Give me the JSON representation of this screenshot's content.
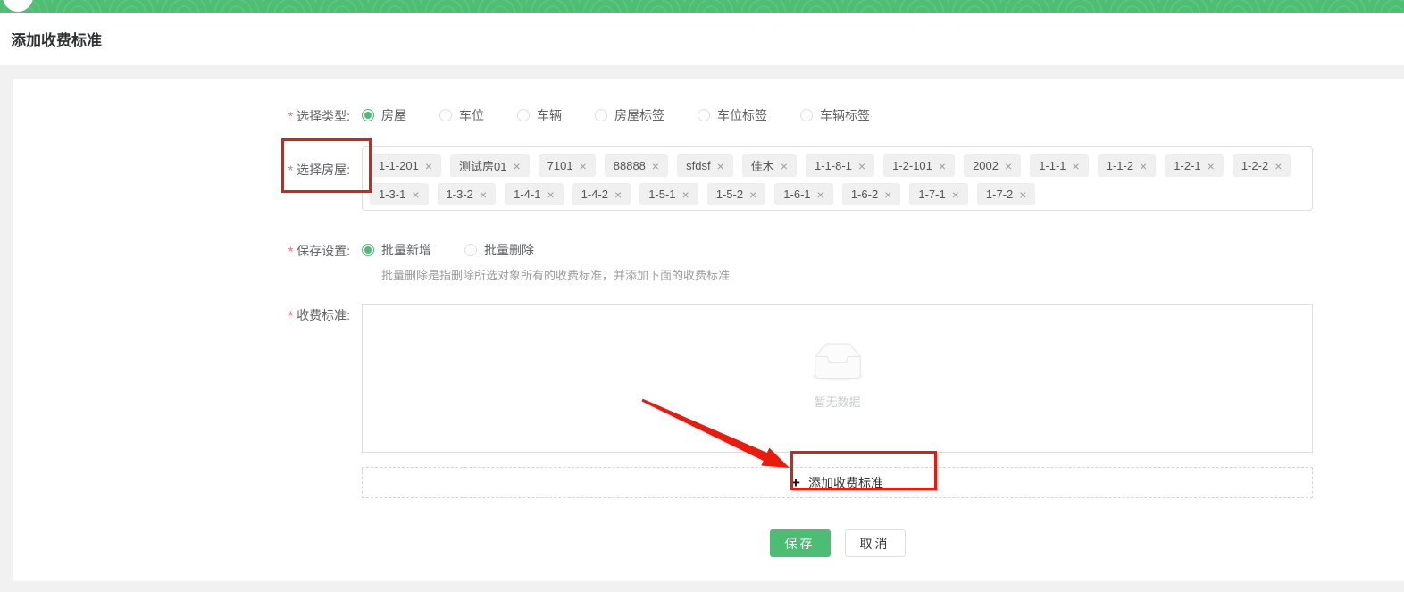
{
  "header": {
    "bar_color": "#4ebe73"
  },
  "page": {
    "title": "添加收费标准"
  },
  "form": {
    "type": {
      "required_marker": "*",
      "label": "选择类型:",
      "options": [
        "房屋",
        "车位",
        "车辆",
        "房屋标签",
        "车位标签",
        "车辆标签"
      ],
      "selected": "房屋"
    },
    "rooms": {
      "required_marker": "*",
      "label": "选择房屋:",
      "remove_icon": "×",
      "tags": [
        "1-1-201",
        "测试房01",
        "7101",
        "88888",
        "sfdsf",
        "佳木",
        "1-1-8-1",
        "1-2-101",
        "2002",
        "1-1-1",
        "1-1-2",
        "1-2-1",
        "1-2-2",
        "1-3-1",
        "1-3-2",
        "1-4-1",
        "1-4-2",
        "1-5-1",
        "1-5-2",
        "1-6-1",
        "1-6-2",
        "1-7-1",
        "1-7-2"
      ]
    },
    "save_mode": {
      "required_marker": "*",
      "label": "保存设置:",
      "options": [
        "批量新增",
        "批量删除"
      ],
      "selected": "批量新增",
      "hint": "批量删除是指删除所选对象所有的收费标准，并添加下面的收费标准"
    },
    "fee_standard": {
      "required_marker": "*",
      "label": "收费标准:",
      "empty_text": "暂无数据",
      "add_icon": "+",
      "add_label": "添加收费标准"
    }
  },
  "actions": {
    "save": "保存",
    "cancel": "取消"
  },
  "annotations": {
    "color": "#ea1b0d"
  }
}
